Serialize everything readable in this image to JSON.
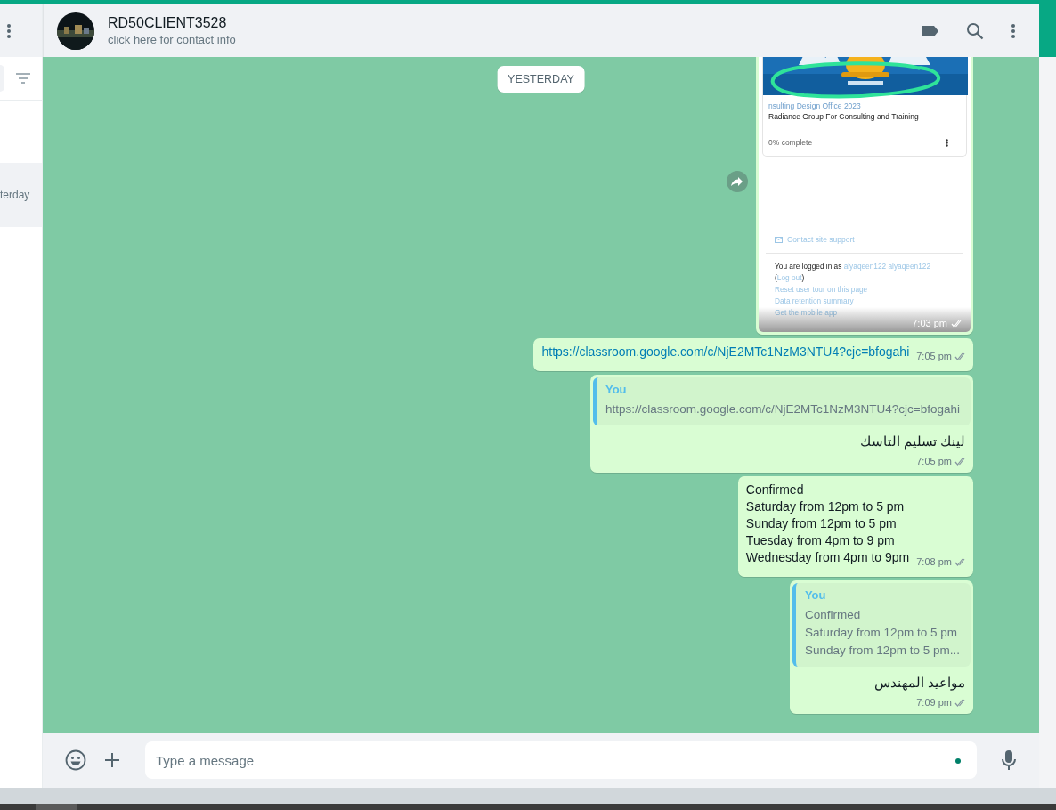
{
  "sidebar": {
    "chats": [
      {
        "time": "terday",
        "selected": true
      }
    ]
  },
  "header": {
    "contact_name": "RD50CLIENT3528",
    "subtitle": "click here for contact info"
  },
  "date_divider": "YESTERDAY",
  "messages": [
    {
      "time": "7:03 pm",
      "screenshot": {
        "course_title": "nsulting Design Office 2023",
        "course_org": "Radiance Group For Consulting and Training",
        "progress": "0% complete",
        "support_link": "Contact site support",
        "logged_in_text": "You are logged in as",
        "user_link": "alyaqeen122 alyaqeen122",
        "logout_prefix": "(",
        "logout_link": "Log out",
        "logout_suffix": ")",
        "links": [
          "Reset user tour on this page",
          "Data retention summary",
          "Get the mobile app"
        ]
      }
    },
    {
      "kind": "link",
      "lines": [
        "https://classroom.google.com/c/NjE2MTc1NzM3NTU4?cjc=bfogahi"
      ],
      "time": "7:05 pm"
    },
    {
      "kind": "reply",
      "quote_author": "You",
      "quote_lines": [
        "https://classroom.google.com/c/NjE2MTc1NzM3NTU4?cjc=bfogahi"
      ],
      "lines": [
        "لينك تسليم التاسك"
      ],
      "time": "7:05 pm"
    },
    {
      "kind": "text",
      "lines": [
        "Confirmed",
        "Saturday from 12pm to 5 pm",
        "Sunday from 12pm to 5 pm",
        "Tuesday from 4pm to 9 pm",
        "Wednesday from 4pm to 9pm"
      ],
      "time": "7:08 pm"
    },
    {
      "kind": "reply",
      "quote_author": "You",
      "quote_lines": [
        "Confirmed",
        "Saturday from 12pm to 5 pm",
        "Sunday from 12pm to 5 pm..."
      ],
      "lines": [
        "مواعيد المهندس"
      ],
      "time": "7:09 pm"
    }
  ],
  "composer": {
    "placeholder": "Type a message"
  }
}
